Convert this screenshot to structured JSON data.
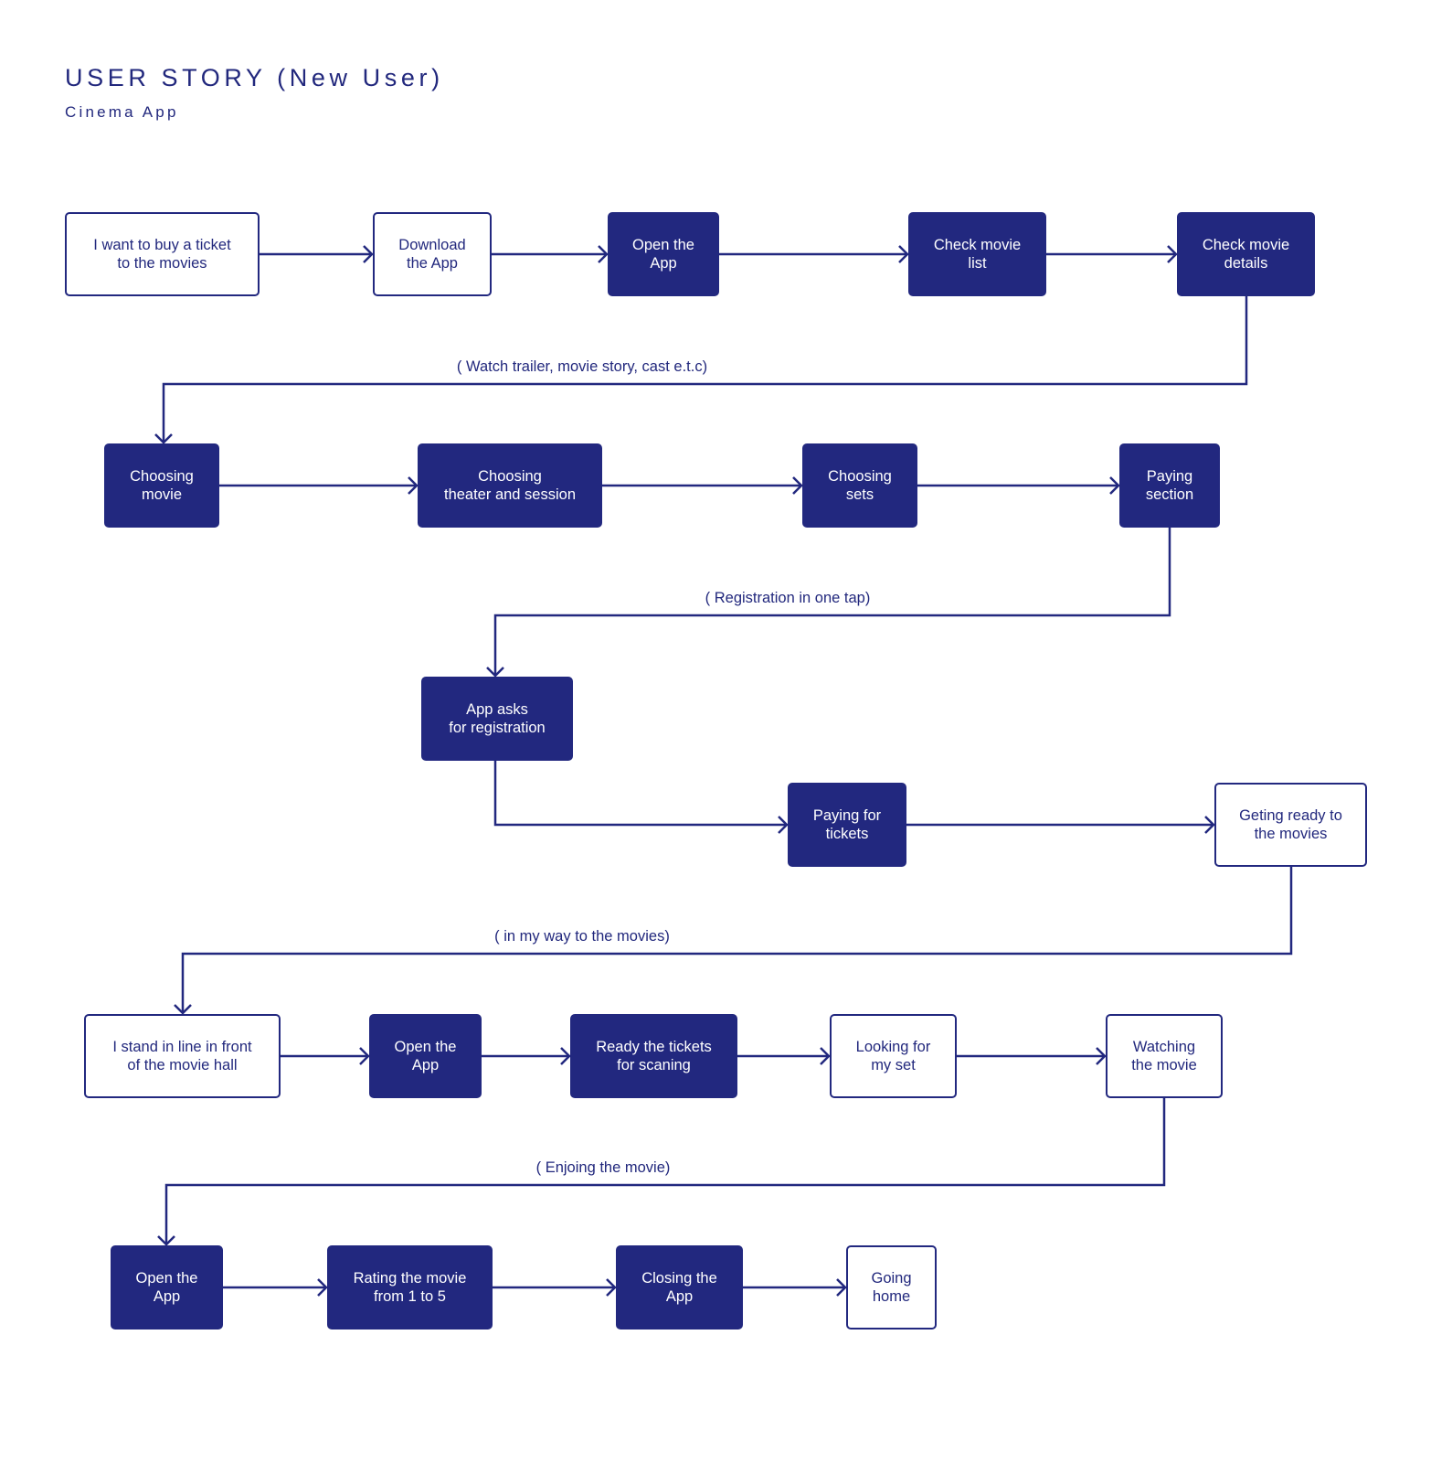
{
  "header": {
    "title": "USER STORY (New User)",
    "subtitle": "Cinema App"
  },
  "colors": {
    "primary": "#22287f",
    "background": "#ffffff",
    "filled_text": "#ffffff"
  },
  "nodes": [
    {
      "id": "n1",
      "text": "I want to buy a ticket\nto the movies",
      "style": "outline"
    },
    {
      "id": "n2",
      "text": "Download\nthe App",
      "style": "outline"
    },
    {
      "id": "n3",
      "text": "Open the\nApp",
      "style": "filled"
    },
    {
      "id": "n4",
      "text": "Check movie\nlist",
      "style": "filled"
    },
    {
      "id": "n5",
      "text": "Check movie\ndetails",
      "style": "filled"
    },
    {
      "id": "n6",
      "text": "Choosing\nmovie",
      "style": "filled"
    },
    {
      "id": "n7",
      "text": "Choosing\ntheater and session",
      "style": "filled"
    },
    {
      "id": "n8",
      "text": "Choosing\nsets",
      "style": "filled"
    },
    {
      "id": "n9",
      "text": "Paying\nsection",
      "style": "filled"
    },
    {
      "id": "n10",
      "text": "App asks\nfor registration",
      "style": "filled"
    },
    {
      "id": "n11",
      "text": "Paying for\ntickets",
      "style": "filled"
    },
    {
      "id": "n12",
      "text": "Geting ready to\nthe movies",
      "style": "outline"
    },
    {
      "id": "n13",
      "text": "I stand in line in front\nof the movie hall",
      "style": "outline"
    },
    {
      "id": "n14",
      "text": "Open the\nApp",
      "style": "filled"
    },
    {
      "id": "n15",
      "text": "Ready the tickets\nfor scaning",
      "style": "filled"
    },
    {
      "id": "n16",
      "text": "Looking for\nmy set",
      "style": "outline"
    },
    {
      "id": "n17",
      "text": "Watching\nthe movie",
      "style": "outline"
    },
    {
      "id": "n18",
      "text": "Open the\nApp",
      "style": "filled"
    },
    {
      "id": "n19",
      "text": "Rating the movie\nfrom 1 to 5",
      "style": "filled"
    },
    {
      "id": "n20",
      "text": "Closing the\nApp",
      "style": "filled"
    },
    {
      "id": "n21",
      "text": "Going\nhome",
      "style": "outline"
    }
  ],
  "edges": [
    {
      "from": "n1",
      "to": "n2"
    },
    {
      "from": "n2",
      "to": "n3"
    },
    {
      "from": "n3",
      "to": "n4"
    },
    {
      "from": "n4",
      "to": "n5"
    },
    {
      "from": "n5",
      "to": "n6",
      "label": "( Watch trailer, movie story, cast e.t.c)"
    },
    {
      "from": "n6",
      "to": "n7"
    },
    {
      "from": "n7",
      "to": "n8"
    },
    {
      "from": "n8",
      "to": "n9"
    },
    {
      "from": "n9",
      "to": "n10",
      "label": "( Registration in one tap)"
    },
    {
      "from": "n10",
      "to": "n11"
    },
    {
      "from": "n11",
      "to": "n12"
    },
    {
      "from": "n12",
      "to": "n13",
      "label": "( in my way to the movies)"
    },
    {
      "from": "n13",
      "to": "n14"
    },
    {
      "from": "n14",
      "to": "n15"
    },
    {
      "from": "n15",
      "to": "n16"
    },
    {
      "from": "n16",
      "to": "n17"
    },
    {
      "from": "n17",
      "to": "n18",
      "label": "( Enjoing the movie)"
    },
    {
      "from": "n18",
      "to": "n19"
    },
    {
      "from": "n19",
      "to": "n20"
    },
    {
      "from": "n20",
      "to": "n21"
    }
  ]
}
